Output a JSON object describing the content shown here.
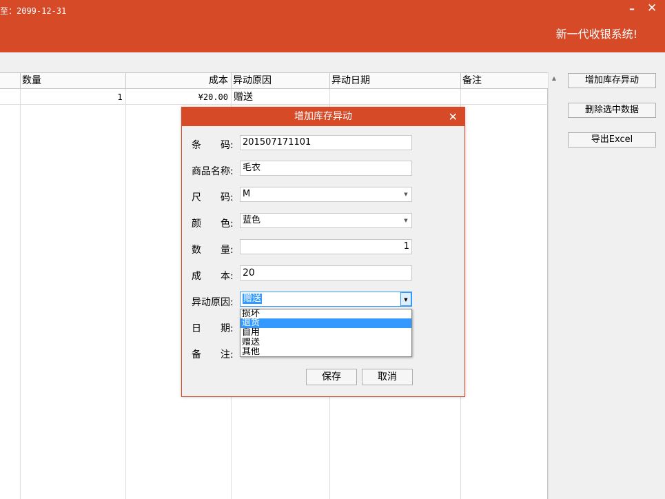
{
  "window": {
    "date_range": "至：2099-12-31",
    "brand": "新一代收银系统!",
    "minimize_glyph": "–",
    "close_glyph": "✕"
  },
  "grid": {
    "columns": [
      "数量",
      "成本",
      "异动原因",
      "异动日期",
      "备注"
    ],
    "rows": [
      {
        "qty": "1",
        "cost": "¥20.00",
        "reason": "赠送",
        "date": "",
        "note": ""
      }
    ]
  },
  "side_buttons": {
    "add": "增加库存异动",
    "delete": "删除选中数据",
    "export": "导出Excel"
  },
  "dialog": {
    "title": "增加库存异动",
    "close_glyph": "✕",
    "fields": {
      "barcode": {
        "label": "条　　码:",
        "value": "201507171101"
      },
      "name": {
        "label": "商品名称:",
        "value": "毛衣"
      },
      "size": {
        "label": "尺　　码:",
        "value": "M"
      },
      "color": {
        "label": "颜　　色:",
        "value": "蓝色"
      },
      "qty": {
        "label": "数　　量:",
        "value": "1"
      },
      "cost": {
        "label": "成　　本:",
        "value": "20"
      },
      "reason": {
        "label": "异动原因:",
        "value": "赠送"
      },
      "date": {
        "label": "日　　期:"
      },
      "note": {
        "label": "备　　注:"
      }
    },
    "reason_options": [
      "损坏",
      "退货",
      "自用",
      "赠送",
      "其他"
    ],
    "reason_highlighted": "退货",
    "save": "保存",
    "cancel": "取消"
  },
  "colors": {
    "accent": "#d64a28",
    "selection": "#3399ff"
  }
}
